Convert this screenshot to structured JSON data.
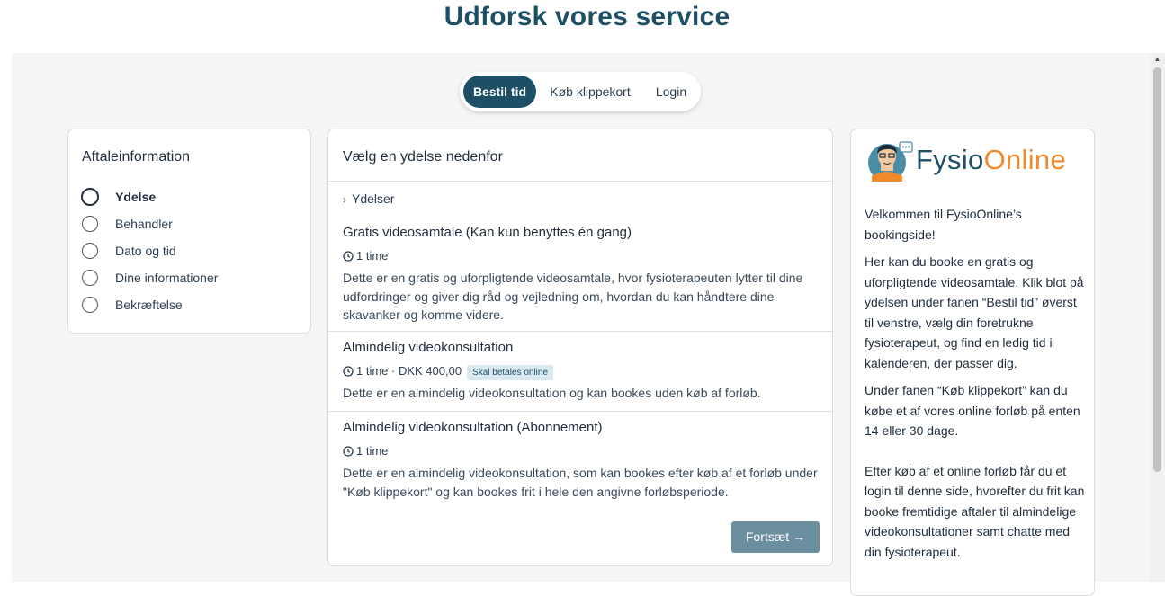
{
  "page": {
    "title": "Udforsk vores service"
  },
  "tabs": [
    {
      "label": "Bestil tid",
      "active": true
    },
    {
      "label": "Køb klippekort",
      "active": false
    },
    {
      "label": "Login",
      "active": false
    }
  ],
  "appointment": {
    "title": "Aftaleinformation",
    "steps": [
      {
        "label": "Ydelse",
        "active": true
      },
      {
        "label": "Behandler",
        "active": false
      },
      {
        "label": "Dato og tid",
        "active": false
      },
      {
        "label": "Dine informationer",
        "active": false
      },
      {
        "label": "Bekræftelse",
        "active": false
      }
    ]
  },
  "main": {
    "title": "Vælg en ydelse nedenfor",
    "breadcrumb": "Ydelser",
    "services": [
      {
        "name": "Gratis videosamtale (Kan kun benyttes én gang)",
        "duration": "1 time",
        "price": "",
        "badge": "",
        "description": "Dette er en gratis og uforpligtende videosamtale, hvor fysioterapeuten lytter til dine udfordringer og giver dig råd og vejledning om, hvordan du kan håndtere dine skavanker og komme videre."
      },
      {
        "name": "Almindelig videokonsultation",
        "duration": "1 time",
        "price": " · DKK 400,00",
        "badge": "Skal betales online",
        "description": "Dette er en almindelig videokonsultation og kan bookes uden køb af forløb."
      },
      {
        "name": "Almindelig videokonsultation (Abonnement)",
        "duration": "1 time",
        "price": "",
        "badge": "",
        "description": "Dette er en almindelig videokonsultation, som kan bookes efter køb af et forløb under \"Køb klippekort\" og kan bookes frit i hele den angivne forløbsperiode."
      }
    ],
    "continue_label": "Fortsæt"
  },
  "sidebar": {
    "logo": {
      "part1": "Fysio",
      "part2": "Online"
    },
    "paragraphs": [
      "Velkommen til FysioOnline’s bookingside!",
      "Her kan du booke en gratis og uforpligtende videosamtale. Klik blot på ydelsen under fanen “Bestil tid” øverst til venstre, vælg din foretrukne fysioterapeut, og find en ledig tid i kalenderen, der passer dig.",
      "Under fanen “Køb klippekort” kan du købe et af vores online forløb på enten 14 eller 30 dage.",
      "Efter køb af et online forløb får du et login til denne side, hvorefter du frit kan booke fremtidige aftaler til almindelige videokonsultationer samt chatte med din fysioterapeut."
    ]
  },
  "colors": {
    "brand": "#1d4f66",
    "accent": "#f08a2a",
    "button": "#6b8f9e"
  }
}
